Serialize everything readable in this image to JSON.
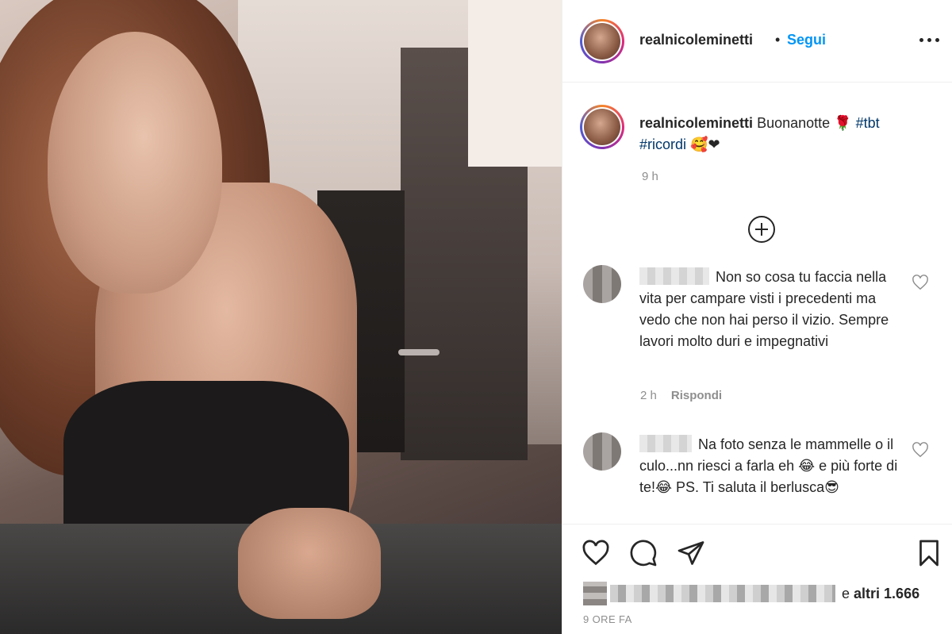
{
  "post": {
    "username": "realnicoleminetti",
    "follow_label": "Segui",
    "caption": {
      "text": "Buonanotte 🌹",
      "hashtag1": "#tbt",
      "hashtag2": "#ricordi",
      "emojis": "🥰❤",
      "time": "9 h"
    },
    "comments": [
      {
        "text": "Non so cosa tu faccia nella vita per campare visti i precedenti ma vedo che non hai perso il vizio. Sempre lavori molto duri e impegnativi",
        "time": "2 h",
        "reply_label": "Rispondi"
      },
      {
        "text": "Na foto senza le mammelle o il culo...nn riesci a farla eh 😂 e più forte di te!😂 PS. Ti saluta il berlusca😎"
      }
    ],
    "likes": {
      "suffix": "e",
      "others_label": "altri 1.666"
    },
    "posted_ago": "9 ORE FA"
  },
  "colors": {
    "accent": "#0095f6",
    "hashtag": "#00376b",
    "muted": "#8e8e8e",
    "text": "#262626"
  },
  "icons": [
    "more-options-icon",
    "add-circle-icon",
    "heart-outline-icon",
    "comment-icon",
    "share-icon",
    "bookmark-icon"
  ]
}
